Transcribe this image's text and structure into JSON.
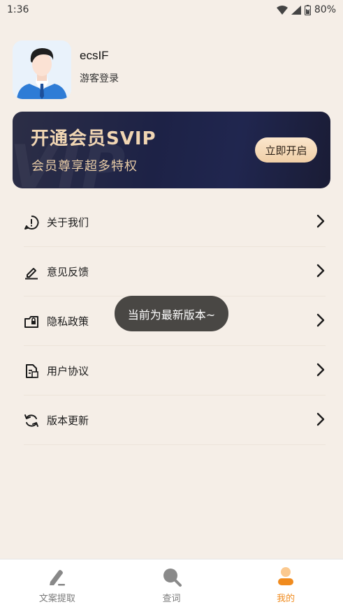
{
  "status_bar": {
    "time": "1:36",
    "battery": "80%",
    "icons": [
      "wifi-icon",
      "signal-icon",
      "battery-icon"
    ]
  },
  "profile": {
    "username": "ecsIF",
    "login_type": "游客登录",
    "avatar": "avatar-businessman"
  },
  "vip": {
    "title": "开通会员SVIP",
    "subtitle": "会员尊享超多特权",
    "watermark": "VIP",
    "button_label": "立即开启",
    "colors": {
      "text": "#F1D6B3",
      "button": "#F0CFA7",
      "background": "#1d2246"
    }
  },
  "menu": {
    "items": [
      {
        "label": "关于我们",
        "icon": "info-icon"
      },
      {
        "label": "意见反馈",
        "icon": "edit-icon"
      },
      {
        "label": "隐私政策",
        "icon": "privacy-icon"
      },
      {
        "label": "用户协议",
        "icon": "document-icon"
      },
      {
        "label": "版本更新",
        "icon": "refresh-icon"
      }
    ]
  },
  "toast": {
    "text": "当前为最新版本~"
  },
  "bottom_nav": {
    "items": [
      {
        "label": "文案提取",
        "icon": "pen-icon",
        "active": false
      },
      {
        "label": "查词",
        "icon": "search-icon",
        "active": false
      },
      {
        "label": "我的",
        "icon": "user-icon",
        "active": true
      }
    ],
    "active_color": "#F08B1E"
  },
  "colors": {
    "page_background": "#F5EEE7"
  }
}
